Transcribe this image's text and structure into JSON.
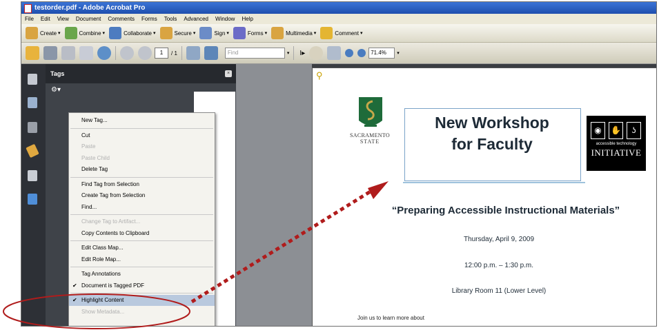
{
  "window": {
    "title": "testorder.pdf - Adobe Acrobat Pro"
  },
  "menubar": [
    "File",
    "Edit",
    "View",
    "Document",
    "Comments",
    "Forms",
    "Tools",
    "Advanced",
    "Window",
    "Help"
  ],
  "toolbar1": [
    {
      "label": "Create",
      "icon": "create-icon",
      "color": "#d9a441"
    },
    {
      "label": "Combine",
      "icon": "combine-icon",
      "color": "#6aa64b"
    },
    {
      "label": "Collaborate",
      "icon": "collaborate-icon",
      "color": "#4d7cc0"
    },
    {
      "label": "Secure",
      "icon": "lock-icon",
      "color": "#d9a441"
    },
    {
      "label": "Sign",
      "icon": "pen-icon",
      "color": "#6b8cc7"
    },
    {
      "label": "Forms",
      "icon": "forms-icon",
      "color": "#6b6bc7"
    },
    {
      "label": "Multimedia",
      "icon": "multimedia-icon",
      "color": "#d9a441"
    },
    {
      "label": "Comment",
      "icon": "comment-icon",
      "color": "#e4b532"
    }
  ],
  "toolbar2": {
    "page_current": "1",
    "page_total": "/ 1",
    "find_placeholder": "Find",
    "zoom": "71.4%"
  },
  "panel": {
    "title": "Tags",
    "close": "×",
    "options": "⚙▾"
  },
  "context_menu": [
    {
      "label": "New Tag...",
      "enabled": true
    },
    {
      "sep": true
    },
    {
      "label": "Cut",
      "enabled": true
    },
    {
      "label": "Paste",
      "enabled": false
    },
    {
      "label": "Paste Child",
      "enabled": false
    },
    {
      "label": "Delete Tag",
      "enabled": true
    },
    {
      "sep": true
    },
    {
      "label": "Find Tag from Selection",
      "enabled": true
    },
    {
      "label": "Create Tag from Selection",
      "enabled": true
    },
    {
      "label": "Find...",
      "enabled": true
    },
    {
      "sep": true
    },
    {
      "label": "Change Tag to Artifact...",
      "enabled": false
    },
    {
      "label": "Copy Contents to Clipboard",
      "enabled": true
    },
    {
      "sep": true
    },
    {
      "label": "Edit Class Map...",
      "enabled": true
    },
    {
      "label": "Edit Role Map...",
      "enabled": true
    },
    {
      "sep": true
    },
    {
      "label": "Tag Annotations",
      "enabled": true
    },
    {
      "label": "Document is Tagged PDF",
      "enabled": true,
      "checked": true
    },
    {
      "sep": true
    },
    {
      "label": "Highlight Content",
      "enabled": true,
      "checked": true,
      "highlighted": true
    },
    {
      "label": "Show Metadata...",
      "enabled": false
    }
  ],
  "document": {
    "logo_line1": "SACRAMENTO",
    "logo_line2": "STATE",
    "headline1": "New Workshop",
    "headline2": "for Faculty",
    "ati_small": "accessible technology",
    "ati_big": "INITIATIVE",
    "subtitle": "“Preparing Accessible Instructional Materials”",
    "date": "Thursday, April 9, 2009",
    "time": "12:00 p.m. – 1:30 p.m.",
    "location": "Library Room 11 (Lower Level)",
    "join": "Join us to learn more about"
  },
  "colors": {
    "annotation": "#b01c1c",
    "sac_green": "#1e6b3a",
    "sac_gold": "#c7a84a",
    "headline": "#1d2a36"
  }
}
